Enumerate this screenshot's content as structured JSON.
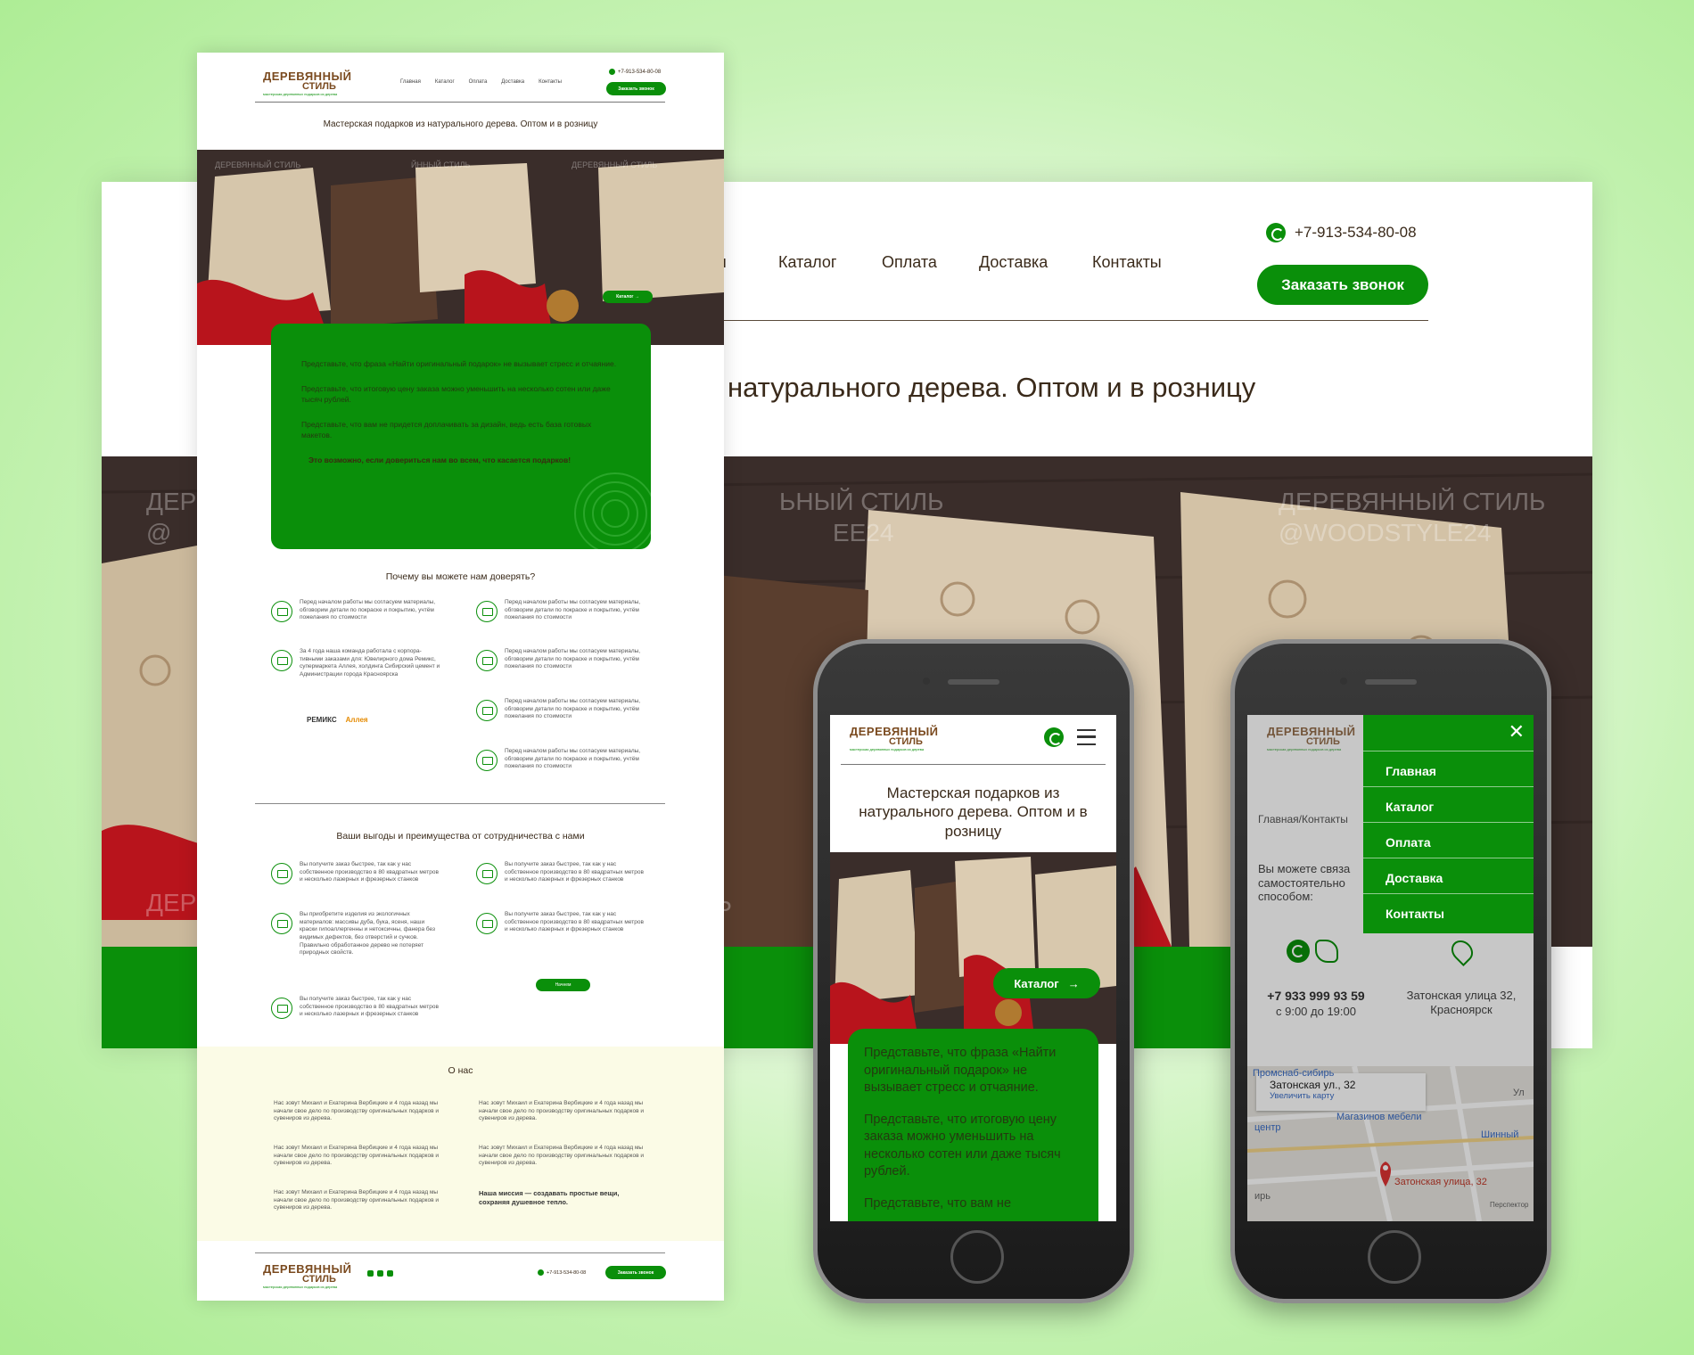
{
  "brand": {
    "line1": "ДЕРЕВЯННЫЙ",
    "line2": "СТИЛЬ",
    "tagline": "мастерская деревянных подарков из дерева"
  },
  "desktop": {
    "nav": [
      "ая",
      "Каталог",
      "Оплата",
      "Доставка",
      "Контакты"
    ],
    "phone": "+7-913-534-80-08",
    "cta": "Заказать звонок",
    "headline": "натурального дерева. Оптом и в розницу",
    "watermark": "ДЕРЕВЯННЫЙ СТИЛЬ @WOODSTYLE24"
  },
  "page": {
    "nav": [
      "Главная",
      "Каталог",
      "Оплата",
      "Доставка",
      "Контакты"
    ],
    "phone": "+7-913-534-80-08",
    "cta": "Заказать звонок",
    "headline": "Мастерская подарков из натурального дерева. Оптом и в розницу",
    "catalog_btn": "Каталог",
    "imagine": [
      "Представьте, что фраза «Найти оригинальный подарок» не вызывает стресс и отчаяние.",
      "Представьте, что итоговую цену заказа можно уменьшить на несколько сотен или даже тысяч рублей.",
      "Представьте, что вам не придется доплачивать за дизайн, ведь есть база готовых макетов."
    ],
    "imagine_bold": "Это возможно, если довериться нам во всем, что касается подарков!",
    "trust_title": "Почему вы можете нам доверять?",
    "trust_left": [
      "Перед началом работы мы согласуем материалы, обговорим детали по покраске и покрытию, учтём пожелания по стоимости",
      "За 4 года наша команда работала с корпора-тивными заказами для: Ювелирного дома Ремикс, супермаркета Аллея, холдинга Сибирский цемент и Администрации города Красноярска"
    ],
    "trust_right": [
      "Перед началом работы мы согласуем материалы, обговорим детали по покраске и покрытию, учтём пожелания по стоимости",
      "Перед началом работы мы согласуем материалы, обговорим детали по покраске и покрытию, учтём пожелания по стоимости",
      "Перед началом работы мы согласуем материалы, обговорим детали по покраске и покрытию, учтём пожелания по стоимости",
      "Перед началом работы мы согласуем материалы, обговорим детали по покраске и покрытию, учтём пожелания по стоимости"
    ],
    "partners": [
      "РЕМИКС",
      "Аллея"
    ],
    "benefits_title": "Ваши выгоды и преимущества от сотрудничества с нами",
    "benefits_left": [
      "Вы получите заказ быстрее, так как у нас собственное производство в 80 квадратных метров и несколько лазерных и фрезерных станков",
      "Вы приобретите изделия из экологичных материалов: массивы дуба, бука, ясеня, наши краски гипоаллергенны и нетоксичны, фанера без видимых дефектов, без отверстий и сучков. Правильно обработанное дерево не потеряет природных свойств.",
      "Вы получите заказ быстрее, так как у нас собственное производство в 80 квадратных метров и несколько лазерных и фрезерных станков"
    ],
    "benefits_right": [
      "Вы получите заказ быстрее, так как у нас собственное производство в 80 квадратных метров и несколько лазерных и фрезерных станков",
      "Вы получите заказ быстрее, так как у нас собственное производство в 80 квадратных метров и несколько лазерных и фрезерных станков"
    ],
    "start_btn": "Начнем",
    "about_title": "О нас",
    "about_text": "Нас зовут Михаил и Екатерина Вербицкие и 4 года назад мы начали свое дело по производству оригинальных подарков и сувениров из дерева.",
    "mission": "Наша миссия — создавать простые вещи, сохраняя душевное тепло.",
    "footer_phone": "+7-913-534-80-08",
    "footer_cta": "Заказать звонок"
  },
  "mobile1": {
    "headline": "Мастерская подарков из натурального дерева. Оптом и в розницу",
    "catalog_btn": "Каталог",
    "imagine": [
      "Представьте, что фраза «Найти оригинальный подарок» не вызывает стресс и отчаяние.",
      "Представьте, что итоговую цену заказа можно уменьшить на несколько сотен или даже тысяч рублей.",
      "Представьте, что вам не"
    ]
  },
  "mobile2": {
    "breadcrumb": "Главная/Контакты",
    "intro": "Вы можете связа самостоятельно способом:",
    "phone": "+7 933 999 93 59",
    "hours": "с 9:00 до 19:00",
    "address": "Затонская улица 32, Красноярск",
    "menu": [
      "Главная",
      "Каталог",
      "Оплата",
      "Доставка",
      "Контакты"
    ],
    "map_card_title": "Затонская ул., 32",
    "map_card_link": "Увеличить карту",
    "map_labels": [
      "Промснаб-сибирь",
      "Магазинов мебели",
      "Шинный",
      "центр",
      "Затонская улица, 32",
      "Ул",
      "ирь",
      "Перспектор"
    ]
  },
  "colors": {
    "green": "#0a8f0a",
    "brown": "#7a4a1f",
    "background": "#abec92"
  }
}
